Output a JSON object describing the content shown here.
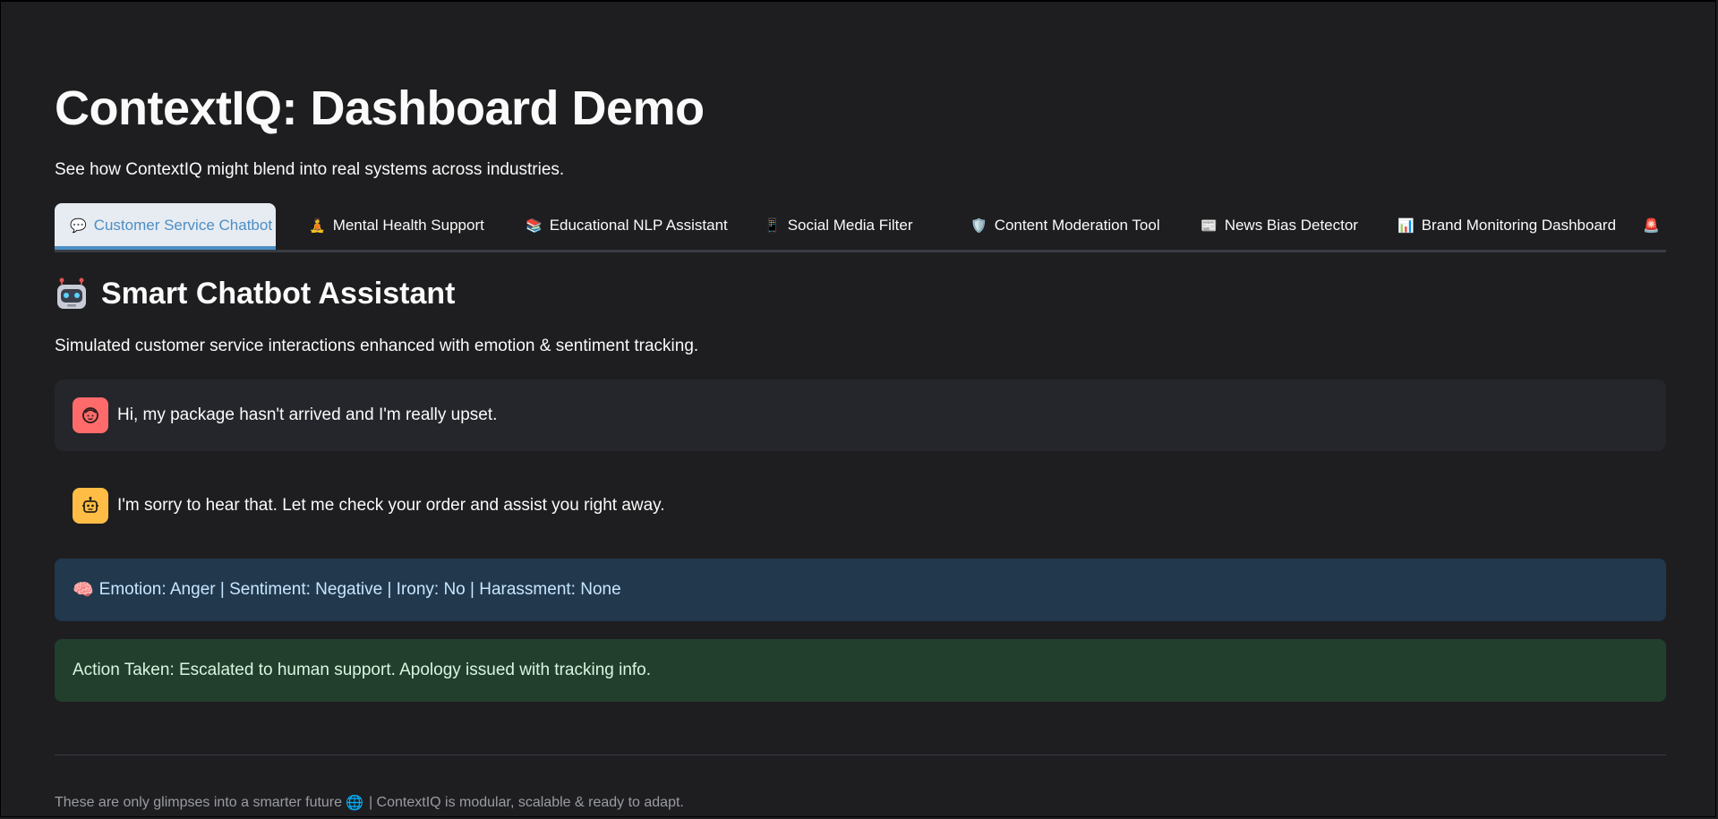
{
  "header": {
    "title": "ContextIQ: Dashboard Demo",
    "subtitle": "See how ContextIQ might blend into real systems across industries."
  },
  "tabs": [
    {
      "icon": "💬",
      "icon_name": "speech-bubble-icon",
      "label": "Customer Service Chatbot",
      "active": true
    },
    {
      "icon": "🧘",
      "icon_name": "meditation-icon",
      "label": "Mental Health Support"
    },
    {
      "icon": "📚",
      "icon_name": "books-icon",
      "label": "Educational NLP Assistant"
    },
    {
      "icon": "📱",
      "icon_name": "phone-icon",
      "label": "Social Media Filter"
    },
    {
      "icon": "🛡️",
      "icon_name": "shield-icon",
      "label": "Content Moderation Tool"
    },
    {
      "icon": "📰",
      "icon_name": "newspaper-icon",
      "label": "News Bias Detector"
    },
    {
      "icon": "📊",
      "icon_name": "bar-chart-icon",
      "label": "Brand Monitoring Dashboard"
    },
    {
      "icon": "🚨",
      "icon_name": "siren-icon",
      "label": ""
    }
  ],
  "section": {
    "icon_name": "robot-icon",
    "title": "Smart Chatbot Assistant",
    "description": "Simulated customer service interactions enhanced with emotion & sentiment tracking."
  },
  "chat": {
    "user_message": "Hi, my package hasn't arrived and I'm really upset.",
    "bot_message": "I'm sorry to hear that. Let me check your order and assist you right away."
  },
  "analysis": {
    "icon": "🧠",
    "text": "Emotion: Anger | Sentiment: Negative | Irony: No | Harassment: None"
  },
  "action": {
    "text": "Action Taken: Escalated to human support. Apology issued with tracking info."
  },
  "footer": {
    "text_before": "These are only glimpses into a smarter future",
    "icon": "🌐",
    "text_after": "| ContextIQ is modular, scalable & ready to adapt."
  },
  "colors": {
    "background": "#1e1e20",
    "accent": "#4d8ec4",
    "user_avatar": "#ff6b6b",
    "bot_avatar": "#ffbd45",
    "info_bg": "#22384d",
    "success_bg": "#223f2e"
  }
}
